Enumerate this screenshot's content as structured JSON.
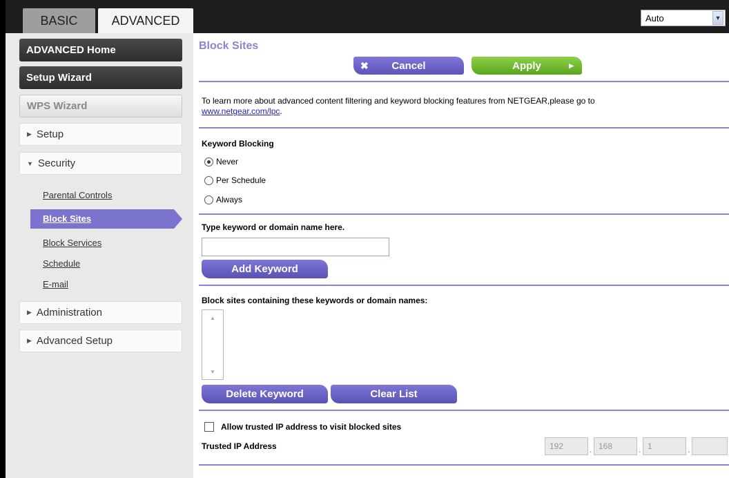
{
  "tabs": {
    "basic": "BASIC",
    "advanced": "ADVANCED"
  },
  "language_select": {
    "selected": "Auto"
  },
  "sidebar": {
    "advanced_home": "ADVANCED Home",
    "setup_wizard": "Setup Wizard",
    "wps_wizard": "WPS Wizard",
    "setup": "Setup",
    "security": "Security",
    "security_items": [
      "Parental Controls",
      "Block Sites",
      "Block Services",
      "Schedule",
      "E-mail"
    ],
    "administration": "Administration",
    "advanced_setup": "Advanced Setup"
  },
  "main": {
    "title": "Block Sites",
    "cancel_label": "Cancel",
    "apply_label": "Apply",
    "intro_text": "To learn more about advanced content filtering and keyword blocking features from NETGEAR,please go to",
    "intro_link": "www.netgear.com/lpc",
    "intro_suffix": ".",
    "keyword_blocking_label": "Keyword Blocking",
    "radio_options": [
      "Never",
      "Per Schedule",
      "Always"
    ],
    "radio_selected": "Never",
    "keyword_input_label": "Type keyword or domain name here.",
    "keyword_input_value": "",
    "add_keyword_label": "Add Keyword",
    "block_list_label": "Block sites containing these keywords or domain names:",
    "delete_keyword_label": "Delete Keyword",
    "clear_list_label": "Clear List",
    "allow_trusted_label": "Allow trusted IP address to visit blocked sites",
    "allow_trusted_checked": false,
    "trusted_ip_label": "Trusted IP Address",
    "trusted_ip": [
      "192",
      "168",
      "1",
      ""
    ]
  },
  "colors": {
    "accent": "#8a83d6",
    "apply_green": "#6cb52c",
    "button_purple": "#6b64c8"
  }
}
